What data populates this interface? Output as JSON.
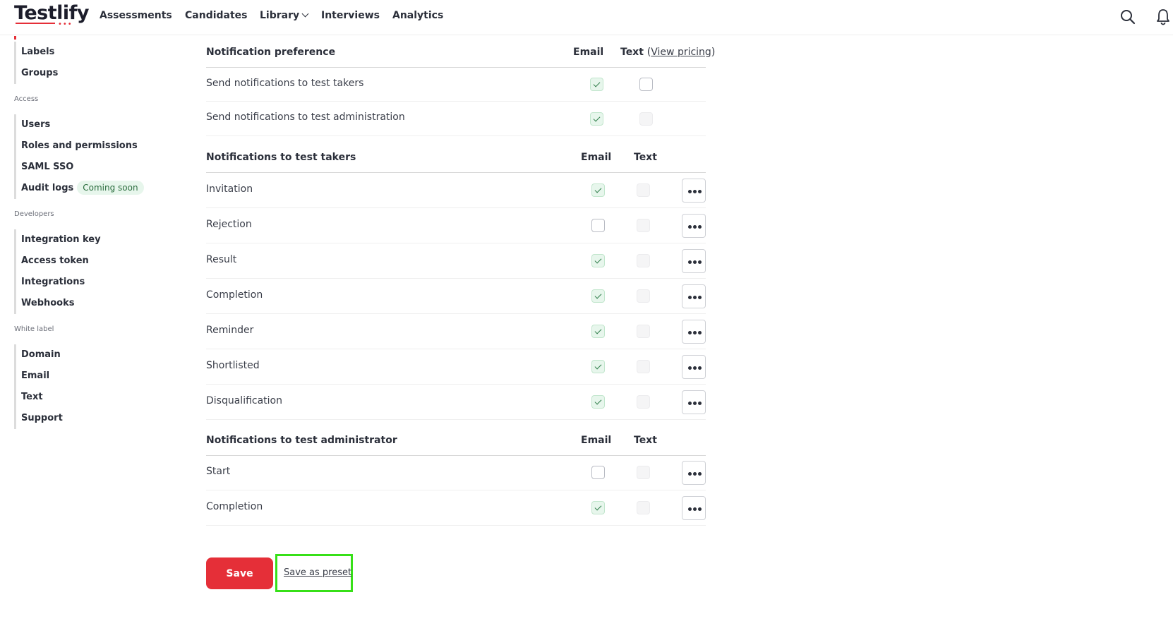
{
  "header": {
    "logo": "Testlify",
    "nav": [
      {
        "label": "Assessments"
      },
      {
        "label": "Candidates"
      },
      {
        "label": "Library"
      },
      {
        "label": "Interviews"
      },
      {
        "label": "Analytics"
      }
    ],
    "icons": [
      "search-icon",
      "bell-icon"
    ]
  },
  "sidebar": {
    "group1": [
      {
        "label": "Labels"
      },
      {
        "label": "Groups"
      }
    ],
    "access_title": "Access",
    "access": [
      {
        "label": "Users"
      },
      {
        "label": "Roles and permissions"
      },
      {
        "label": "SAML SSO"
      },
      {
        "label": "Audit logs",
        "badge": "Coming soon"
      }
    ],
    "developers_title": "Developers",
    "developers": [
      {
        "label": "Integration key"
      },
      {
        "label": "Access token"
      },
      {
        "label": "Integrations"
      },
      {
        "label": "Webhooks"
      }
    ],
    "whitelabel_title": "White label",
    "whitelabel": [
      {
        "label": "Domain"
      },
      {
        "label": "Email"
      },
      {
        "label": "Text"
      },
      {
        "label": "Support"
      }
    ]
  },
  "preferences": {
    "title": "Notification preference",
    "email_col": "Email",
    "text_col": "Text",
    "pricing_link": "View pricing",
    "rows": [
      {
        "label": "Send notifications to test takers",
        "email": true,
        "text": false,
        "text_disabled": false
      },
      {
        "label": "Send notifications to test administration",
        "email": true,
        "text": false,
        "text_disabled": true
      }
    ]
  },
  "takers": {
    "title": "Notifications to test takers",
    "email_col": "Email",
    "text_col": "Text",
    "rows": [
      {
        "label": "Invitation",
        "email": true
      },
      {
        "label": "Rejection",
        "email": false
      },
      {
        "label": "Result",
        "email": true
      },
      {
        "label": "Completion",
        "email": true
      },
      {
        "label": "Reminder",
        "email": true
      },
      {
        "label": "Shortlisted",
        "email": true
      },
      {
        "label": "Disqualification",
        "email": true
      }
    ]
  },
  "admin": {
    "title": "Notifications to test administrator",
    "email_col": "Email",
    "text_col": "Text",
    "rows": [
      {
        "label": "Start",
        "email": false
      },
      {
        "label": "Completion",
        "email": true
      }
    ]
  },
  "actions": {
    "save": "Save",
    "save_preset": "Save as preset"
  },
  "colors": {
    "brand": "#e52f38",
    "checked_bg": "#e7f6ec",
    "highlight": "#37e018"
  }
}
